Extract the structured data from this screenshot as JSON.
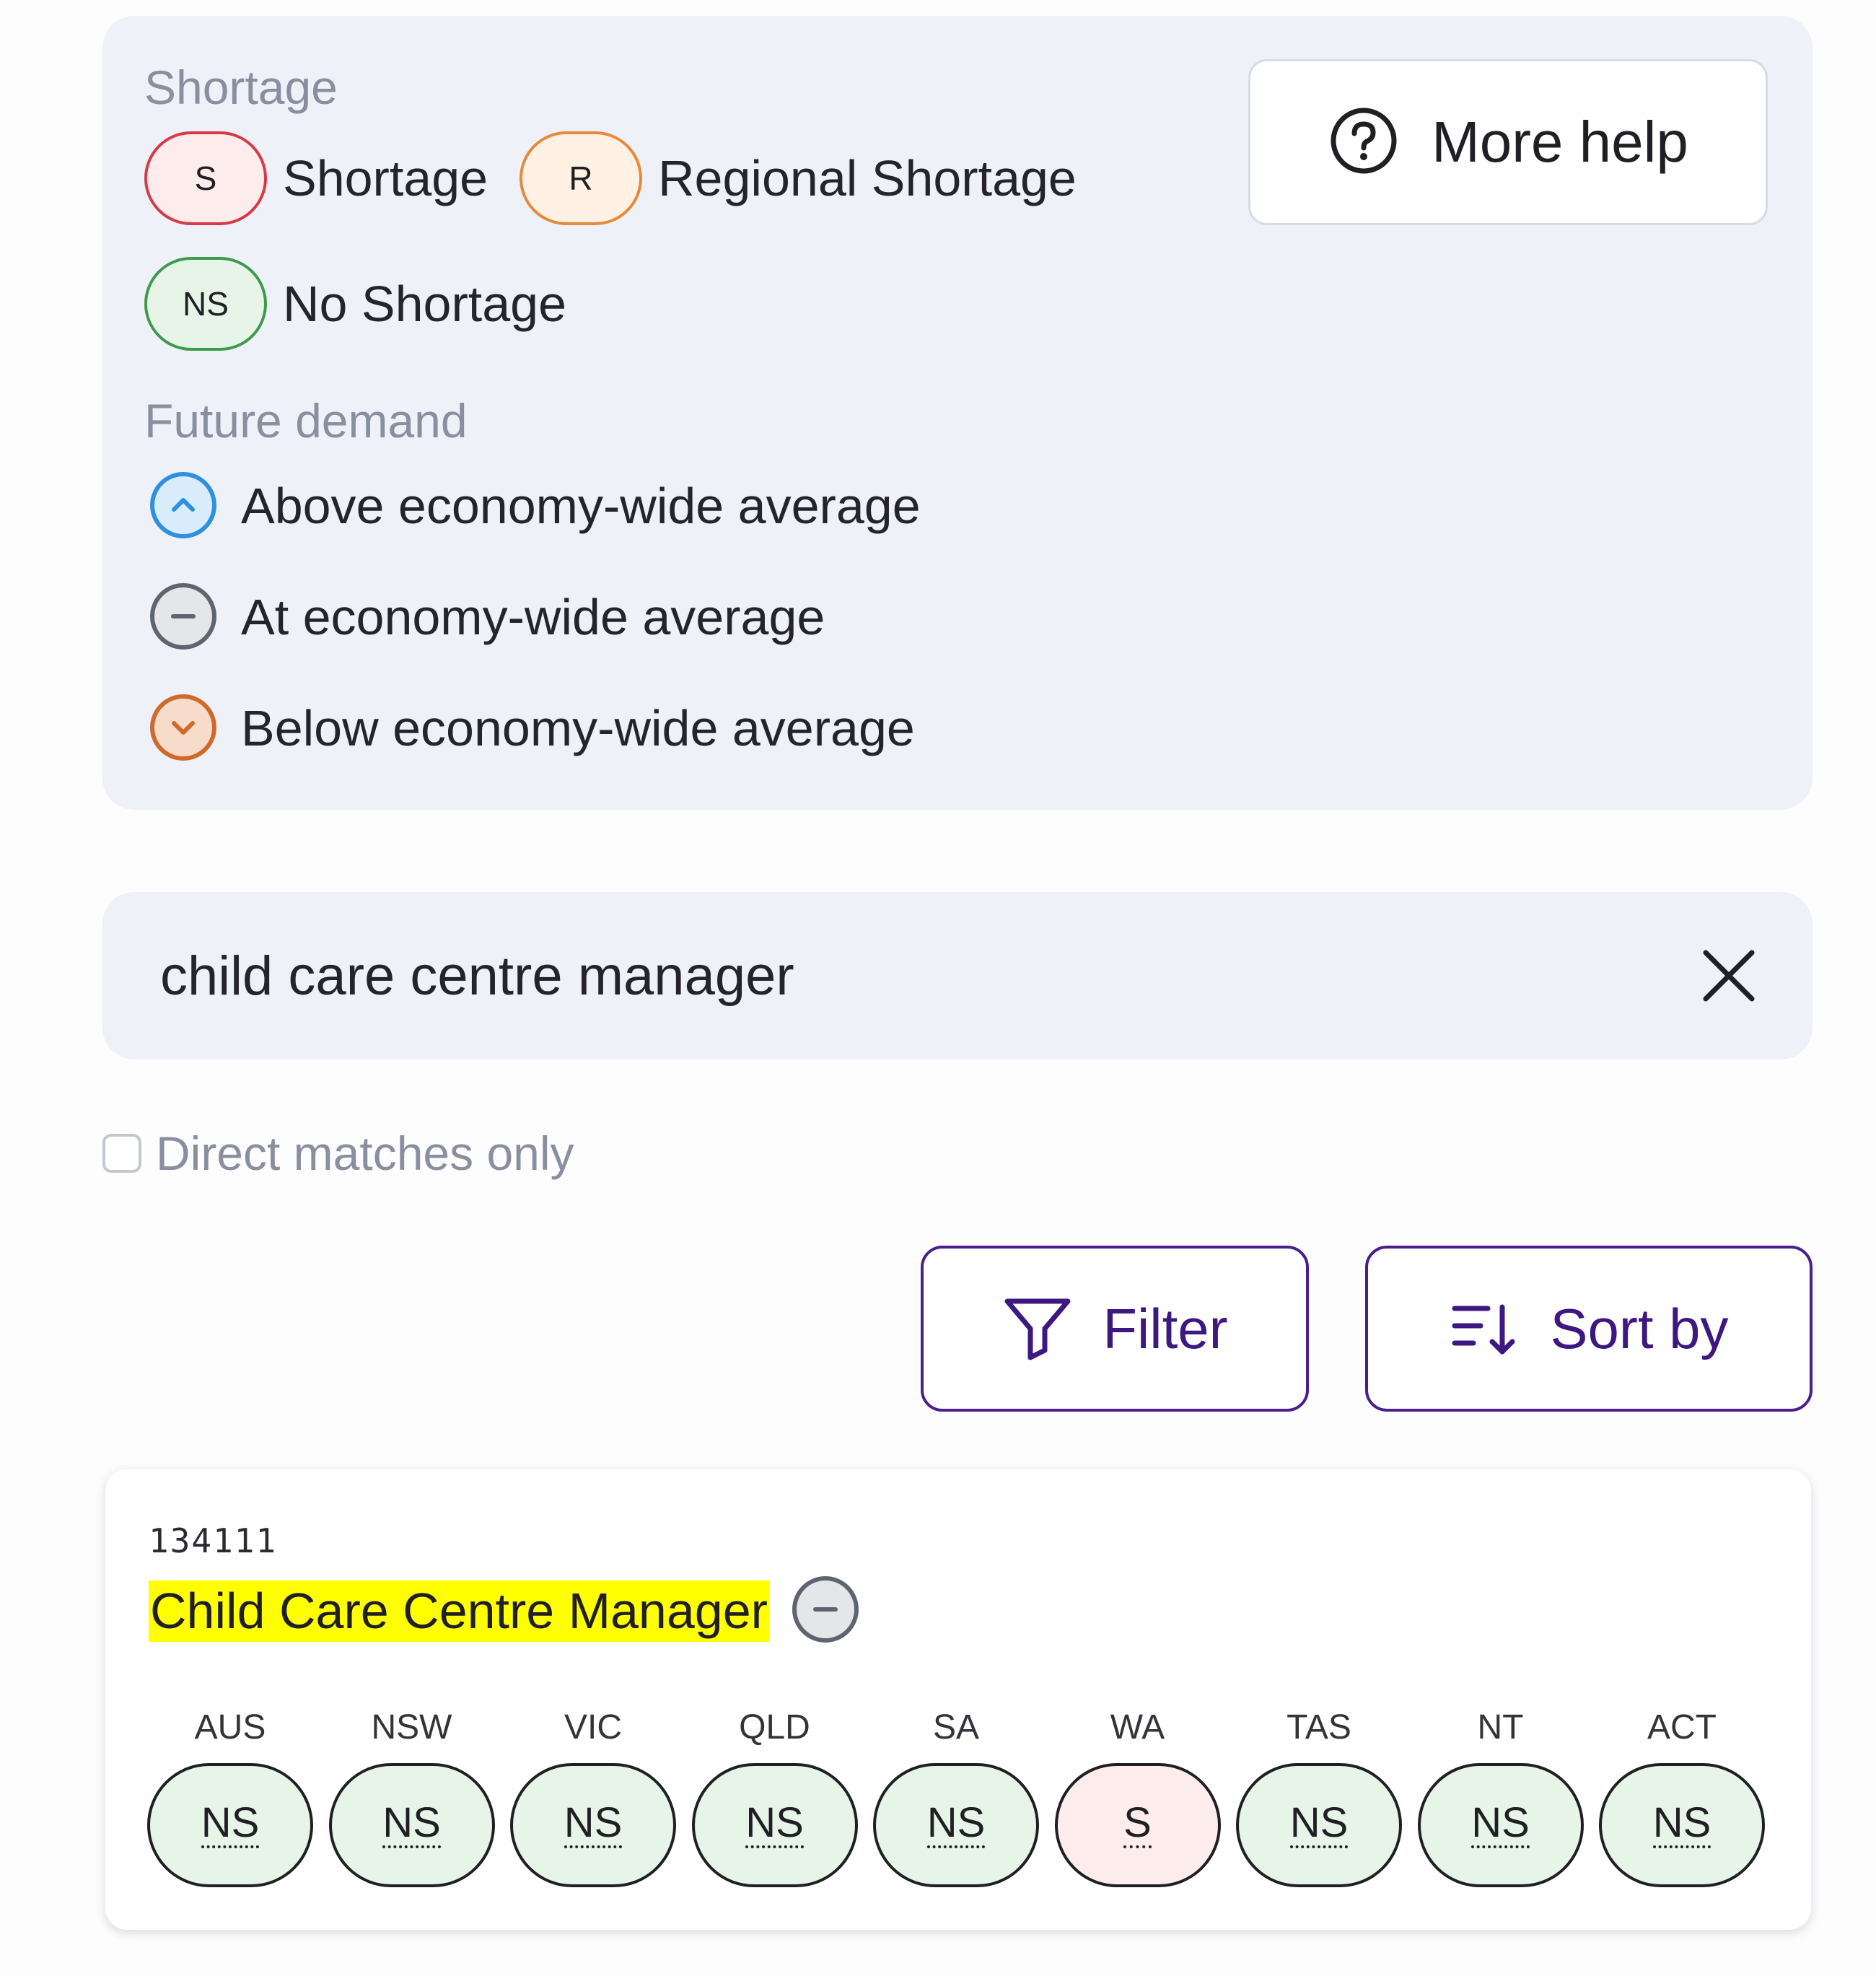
{
  "legend": {
    "shortage_heading": "Shortage",
    "items": [
      {
        "code": "S",
        "label": "Shortage",
        "status": "shortage"
      },
      {
        "code": "R",
        "label": "Regional Shortage",
        "status": "regional"
      },
      {
        "code": "NS",
        "label": "No Shortage",
        "status": "none"
      }
    ],
    "future_heading": "Future demand",
    "demand": [
      {
        "label": "Above economy-wide average",
        "icon": "chevron-up-icon"
      },
      {
        "label": "At economy-wide average",
        "icon": "minus-icon"
      },
      {
        "label": "Below economy-wide average",
        "icon": "chevron-down-icon"
      }
    ]
  },
  "help": {
    "label": "More help",
    "icon": "question-circle-icon"
  },
  "search": {
    "value": "child care centre manager",
    "clear_icon": "close-icon"
  },
  "direct_matches": {
    "label": "Direct matches only",
    "checked": false
  },
  "actions": {
    "filter_label": "Filter",
    "sort_label": "Sort by"
  },
  "result": {
    "code": "134111",
    "title": "Child Care Centre Manager",
    "demand_icon": "minus-icon",
    "states": [
      {
        "name": "AUS",
        "rating": "NS"
      },
      {
        "name": "NSW",
        "rating": "NS"
      },
      {
        "name": "VIC",
        "rating": "NS"
      },
      {
        "name": "QLD",
        "rating": "NS"
      },
      {
        "name": "SA",
        "rating": "NS"
      },
      {
        "name": "WA",
        "rating": "S"
      },
      {
        "name": "TAS",
        "rating": "NS"
      },
      {
        "name": "NT",
        "rating": "NS"
      },
      {
        "name": "ACT",
        "rating": "NS"
      }
    ]
  },
  "colors": {
    "shortage_border": "#d63a46",
    "regional_border": "#e58a3a",
    "no_shortage_border": "#3f9a4d",
    "accent_purple": "#4a1e8c",
    "highlight": "#ffff00"
  }
}
